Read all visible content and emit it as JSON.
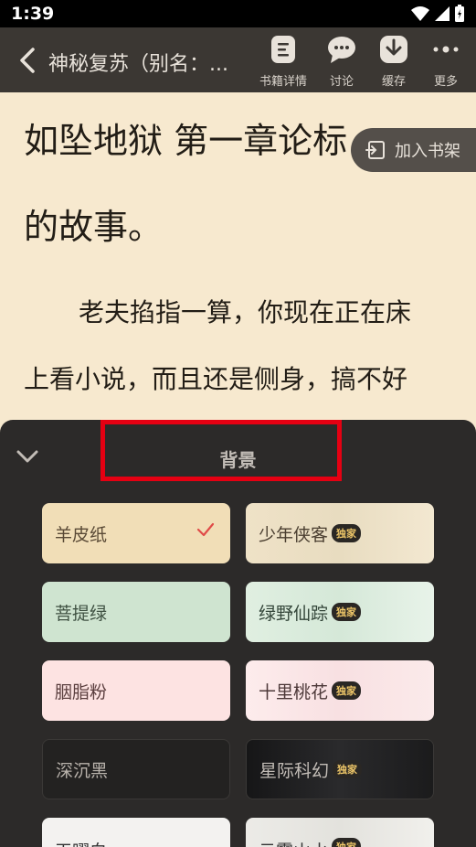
{
  "status": {
    "time": "1:39"
  },
  "topbar": {
    "book_title": "神秘复苏（别名：...",
    "tools": [
      {
        "label": "书籍详情",
        "icon": "book-details-icon"
      },
      {
        "label": "讨论",
        "icon": "chat-bubble-icon"
      },
      {
        "label": "缓存",
        "icon": "download-icon"
      },
      {
        "label": "更多",
        "icon": "more-dots-icon"
      }
    ]
  },
  "reader": {
    "lines": [
      "如坠地狱 第一章论标",
      "的故事。",
      "老夫掐指一算，你现在正在床",
      "上看小说，而且还是侧身，搞不好"
    ],
    "add_to_shelf": "加入书架"
  },
  "panel": {
    "title": "背景",
    "exclusive_badge": "独家",
    "backgrounds": [
      {
        "label": "羊皮纸",
        "selected": true,
        "exclusive": false,
        "color": "#f1deb7",
        "text_color": "#5a4a36"
      },
      {
        "label": "少年侠客",
        "selected": false,
        "exclusive": true,
        "color": "#efe2c7",
        "text_color": "#4a3e30"
      },
      {
        "label": "菩提绿",
        "selected": false,
        "exclusive": false,
        "color": "#cfe4d0",
        "text_color": "#3f5142"
      },
      {
        "label": "绿野仙踪",
        "selected": false,
        "exclusive": true,
        "color": "#e0efe1",
        "text_color": "#34463a"
      },
      {
        "label": "胭脂粉",
        "selected": false,
        "exclusive": false,
        "color": "#fde3e2",
        "text_color": "#5a3e3e"
      },
      {
        "label": "十里桃花",
        "selected": false,
        "exclusive": true,
        "color": "#fdecec",
        "text_color": "#4c3838"
      },
      {
        "label": "深沉黑",
        "selected": false,
        "exclusive": false,
        "color": "#232221",
        "text_color": "#b8b2ab"
      },
      {
        "label": "星际科幻",
        "selected": false,
        "exclusive": true,
        "color": "#1b1b1c",
        "text_color": "#c2bcb6"
      },
      {
        "label": "天曜白",
        "selected": false,
        "exclusive": false,
        "color": "#f3f2f0",
        "text_color": "#333"
      },
      {
        "label": "云雾山水",
        "selected": false,
        "exclusive": true,
        "color": "#ecebe7",
        "text_color": "#333"
      }
    ],
    "accent_color": "#e04b48",
    "highlight_color": "#e50012"
  }
}
